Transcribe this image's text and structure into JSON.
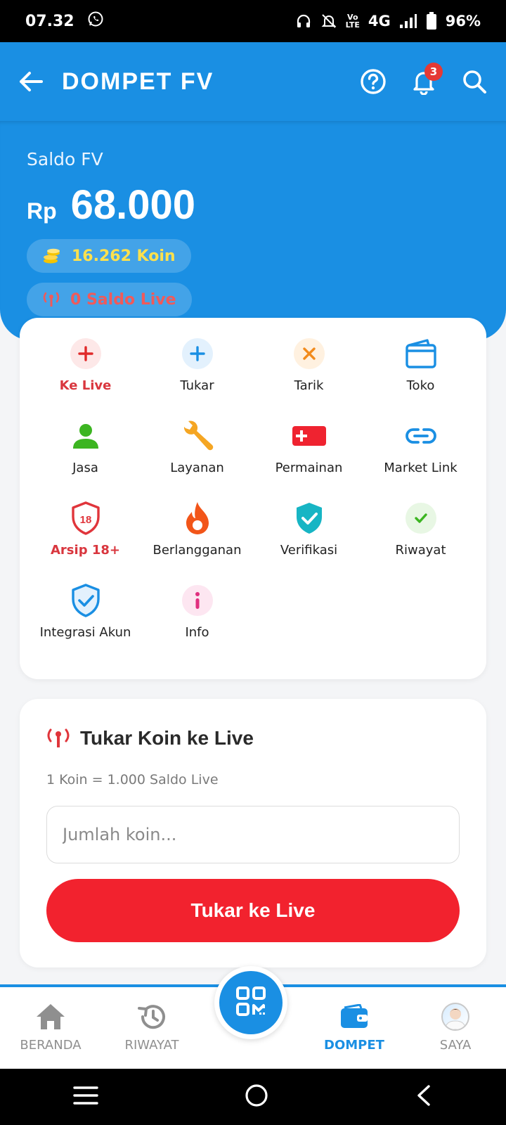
{
  "status_bar": {
    "time": "07.32",
    "network": "4G",
    "battery": "96%"
  },
  "app_bar": {
    "title": "DOMPET FV",
    "notification_count": "3"
  },
  "balance": {
    "label": "Saldo FV",
    "currency": "Rp",
    "amount": "68.000",
    "koin": "16.262 Koin",
    "saldo_live": "0 Saldo Live"
  },
  "menu": {
    "items": [
      {
        "label": "Ke Live",
        "icon": "plus-icon"
      },
      {
        "label": "Tukar",
        "icon": "plus-icon"
      },
      {
        "label": "Tarik",
        "icon": "x-icon"
      },
      {
        "label": "Toko",
        "icon": "wallet-icon"
      },
      {
        "label": "Jasa",
        "icon": "person-icon"
      },
      {
        "label": "Layanan",
        "icon": "wrench-icon"
      },
      {
        "label": "Permainan",
        "icon": "game-icon"
      },
      {
        "label": "Market Link",
        "icon": "link-icon"
      },
      {
        "label": "Arsip 18+",
        "icon": "shield-18-icon"
      },
      {
        "label": "Berlangganan",
        "icon": "flame-icon"
      },
      {
        "label": "Verifikasi",
        "icon": "shield-check-icon"
      },
      {
        "label": "Riwayat",
        "icon": "check-icon"
      },
      {
        "label": "Integrasi Akun",
        "icon": "shield-check-icon"
      },
      {
        "label": "Info",
        "icon": "info-icon"
      }
    ]
  },
  "exchange": {
    "title": "Tukar Koin ke Live",
    "rate": "1 Koin = 1.000 Saldo Live",
    "placeholder": "Jumlah koin...",
    "button": "Tukar ke Live"
  },
  "bottom_nav": {
    "beranda": "BERANDA",
    "riwayat": "RIWAYAT",
    "dompet": "DOMPET",
    "saya": "SAYA"
  },
  "colors": {
    "primary": "#1a8fe3",
    "danger": "#f2222e",
    "koin": "#ffe14d"
  }
}
